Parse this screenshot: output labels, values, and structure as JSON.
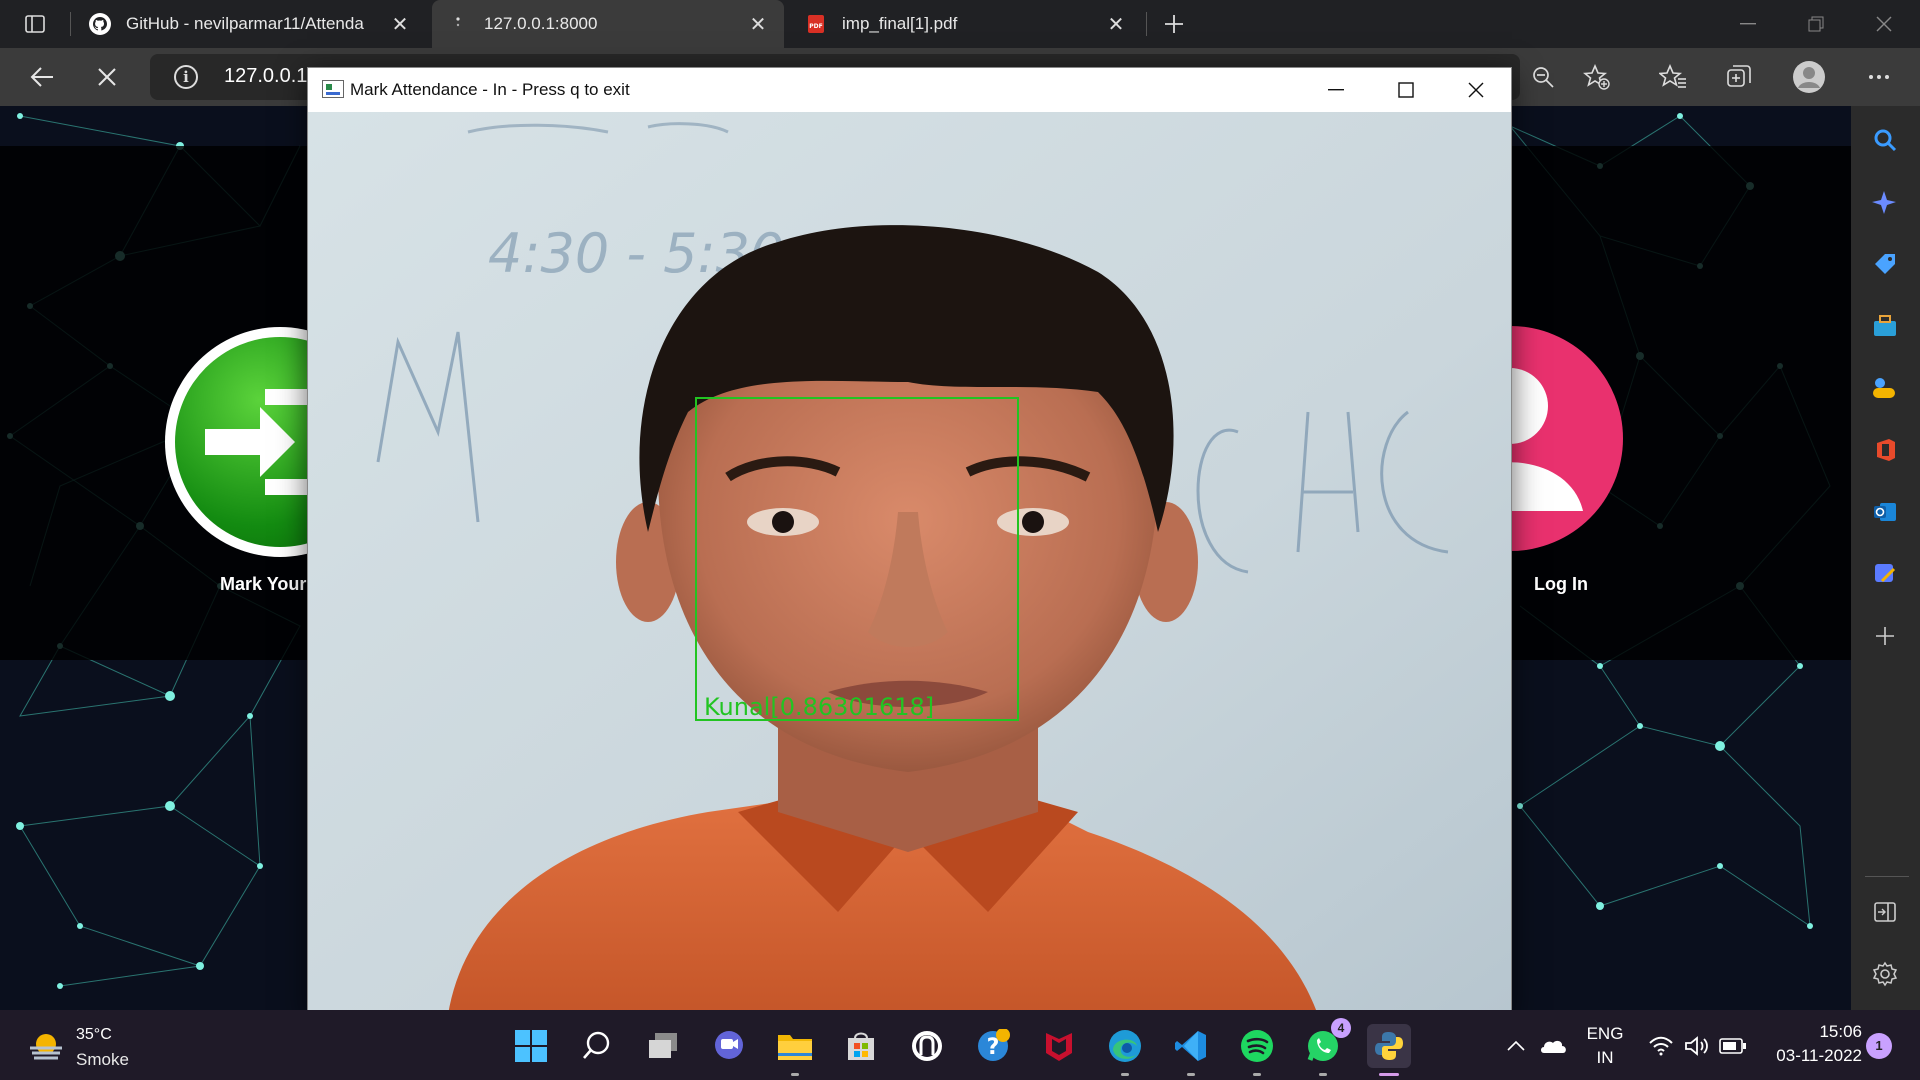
{
  "browser": {
    "tabs": [
      {
        "title": "GitHub - nevilparmar11/Attenda",
        "icon": "github-icon"
      },
      {
        "title": "127.0.0.1:8000",
        "icon": "loading-icon"
      },
      {
        "title": "imp_final[1].pdf",
        "icon": "pdf-icon"
      }
    ],
    "address": "127.0.0.1:"
  },
  "website": {
    "mark_label": "Mark Your",
    "login_label": "Log In",
    "accent_mark": "#19a21b",
    "accent_login": "#e9316e"
  },
  "cv_window": {
    "title": "Mark Attendance - In - Press q to exit",
    "detection": {
      "label": "Kunal[0.86301618]",
      "color": "#22c422"
    },
    "whiteboard_text": "4:30 - 5:30pm"
  },
  "taskbar": {
    "weather": {
      "temp": "35°C",
      "desc": "Smoke"
    },
    "apps": [
      "start-icon",
      "search-icon",
      "task-view-icon",
      "teams-chat-icon",
      "file-explorer-icon",
      "microsoft-store-icon",
      "github-desktop-icon",
      "help-icon",
      "mcafee-icon",
      "edge-icon",
      "vscode-icon",
      "spotify-icon",
      "whatsapp-icon",
      "python-icon"
    ],
    "whatsapp_badge": "4",
    "language_top": "ENG",
    "language_bottom": "IN",
    "time": "15:06",
    "date": "03-11-2022",
    "notification_count": "1"
  }
}
